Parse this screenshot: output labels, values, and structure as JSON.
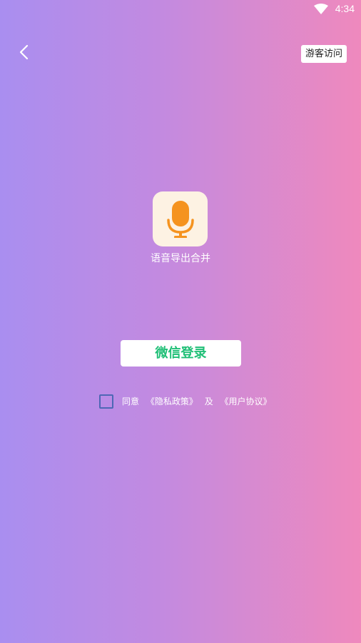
{
  "status_bar": {
    "time": "4:34",
    "wifi_icon": "wifi-icon"
  },
  "header": {
    "back_icon": "chevron-left-icon",
    "guest_label": "游客访问"
  },
  "app": {
    "logo_icon": "microphone-icon",
    "name": "语音导出合并"
  },
  "login": {
    "wechat_label": "微信登录"
  },
  "agreement": {
    "checked": false,
    "prefix": "同意",
    "privacy_label": "《隐私政策》",
    "conjunction": "及",
    "user_agreement_label": "《用户协议》"
  },
  "colors": {
    "gradient_left": "#a98ef0",
    "gradient_right": "#ef89bd",
    "mic_orange": "#f5931f",
    "wechat_green": "#1fbf76",
    "checkbox_blue": "#4e67b5"
  }
}
